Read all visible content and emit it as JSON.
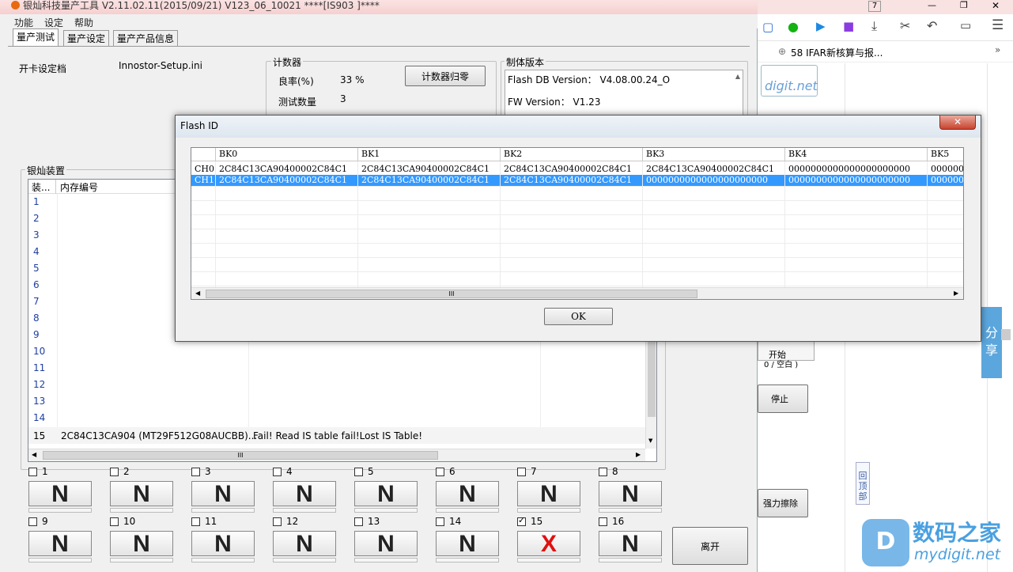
{
  "app": {
    "title": "银灿科技量产工具 V2.11.02.11(2015/09/21)    V123_06_10021          ****[IS903 ]****",
    "menu": [
      "功能",
      "设定",
      "帮助"
    ],
    "tabs": [
      "量产测试",
      "量产设定",
      "量产产品信息"
    ]
  },
  "card_setting": {
    "label": "开卡设定档",
    "value": "Innostor-Setup.ini"
  },
  "counter": {
    "title": "计数器",
    "yield_label": "良率(%)",
    "yield_value": "33 %",
    "test_count_label": "测试数量",
    "test_count_value": "3",
    "reset_button": "计数器归零"
  },
  "firmware": {
    "title": "制体版本",
    "flash_db": "Flash DB Version：  V4.08.00.24_O",
    "fw": "FW Version：   V1.23"
  },
  "devices": {
    "title": "银灿装置",
    "columns": [
      "装...",
      "内存编号"
    ],
    "rows": [
      "1",
      "2",
      "3",
      "4",
      "5",
      "6",
      "7",
      "8",
      "9",
      "10",
      "11",
      "12",
      "13",
      "14",
      "15"
    ],
    "row15": {
      "id": "15",
      "flash": "2C84C13CA904 (MT29F512G08AUCBB)...",
      "status": "Fail!  Read   IS table fail!Lost   IS Table!"
    },
    "scroll_mark": "III"
  },
  "slots": [
    {
      "n": "1",
      "state": "N",
      "checked": false
    },
    {
      "n": "2",
      "state": "N",
      "checked": false
    },
    {
      "n": "3",
      "state": "N",
      "checked": false
    },
    {
      "n": "4",
      "state": "N",
      "checked": false
    },
    {
      "n": "5",
      "state": "N",
      "checked": false
    },
    {
      "n": "6",
      "state": "N",
      "checked": false
    },
    {
      "n": "7",
      "state": "N",
      "checked": false
    },
    {
      "n": "8",
      "state": "N",
      "checked": false
    },
    {
      "n": "9",
      "state": "N",
      "checked": false
    },
    {
      "n": "10",
      "state": "N",
      "checked": false
    },
    {
      "n": "11",
      "state": "N",
      "checked": false
    },
    {
      "n": "12",
      "state": "N",
      "checked": false
    },
    {
      "n": "13",
      "state": "N",
      "checked": false
    },
    {
      "n": "14",
      "state": "N",
      "checked": false
    },
    {
      "n": "15",
      "state": "X",
      "checked": true
    },
    {
      "n": "16",
      "state": "N",
      "checked": false
    }
  ],
  "buttons": {
    "start": "开始",
    "start_sub": "0 / 空白 )",
    "stop": "停止",
    "force_erase": "强力擦除",
    "exit": "离开"
  },
  "browser": {
    "bookmark": "58 IFAR新核算与报...",
    "share": "分享",
    "back_top": "回顶部",
    "watermark_cn": "数码之家",
    "watermark_en": "mydigit.net",
    "badge": "7"
  },
  "dialog": {
    "title": "Flash ID",
    "columns": [
      "BK0",
      "BK1",
      "BK2",
      "BK3",
      "BK4",
      "BK5"
    ],
    "rows": [
      {
        "ch": "CH0",
        "cells": [
          "2C84C13CA90400002C84C1",
          "2C84C13CA90400002C84C1",
          "2C84C13CA90400002C84C1",
          "2C84C13CA90400002C84C1",
          "0000000000000000000000",
          "000000"
        ]
      },
      {
        "ch": "CH1",
        "cells": [
          "2C84C13CA90400002C84C1",
          "2C84C13CA90400002C84C1",
          "2C84C13CA90400002C84C1",
          "0000000000000000000000",
          "0000000000000000000000",
          "000000"
        ]
      }
    ],
    "scroll_mark": "III",
    "ok_button": "OK"
  },
  "colors": {
    "selection": "#3399ff",
    "fail": "#e01010",
    "accent_blue": "#1e5aa8"
  }
}
